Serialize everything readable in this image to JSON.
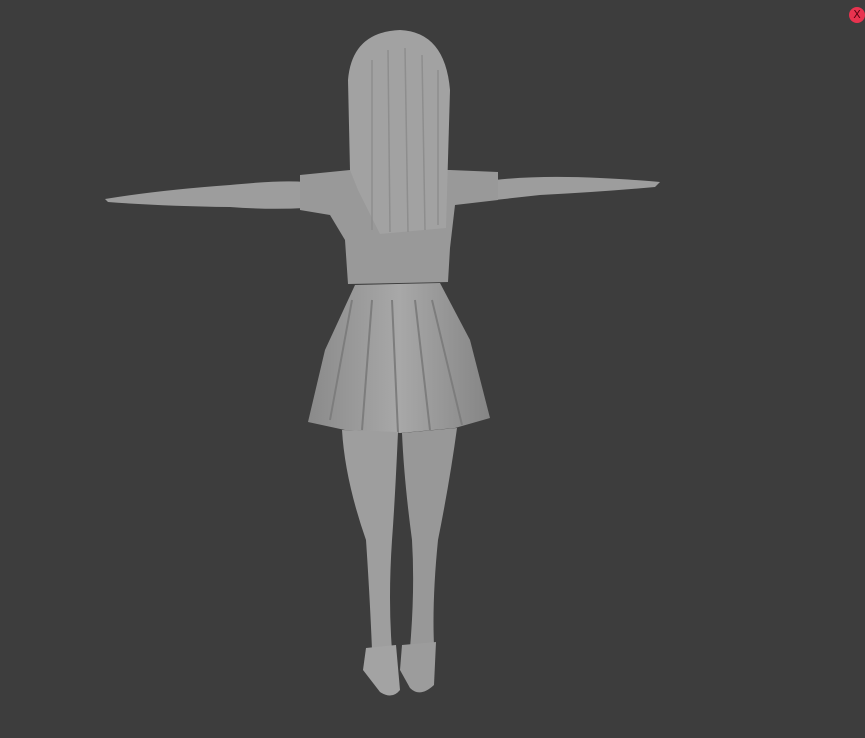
{
  "close_button": {
    "label": "X",
    "color": "#e8334f"
  },
  "viewport": {
    "background": "#3d3d3d",
    "model_color": "#9a9a9a"
  }
}
